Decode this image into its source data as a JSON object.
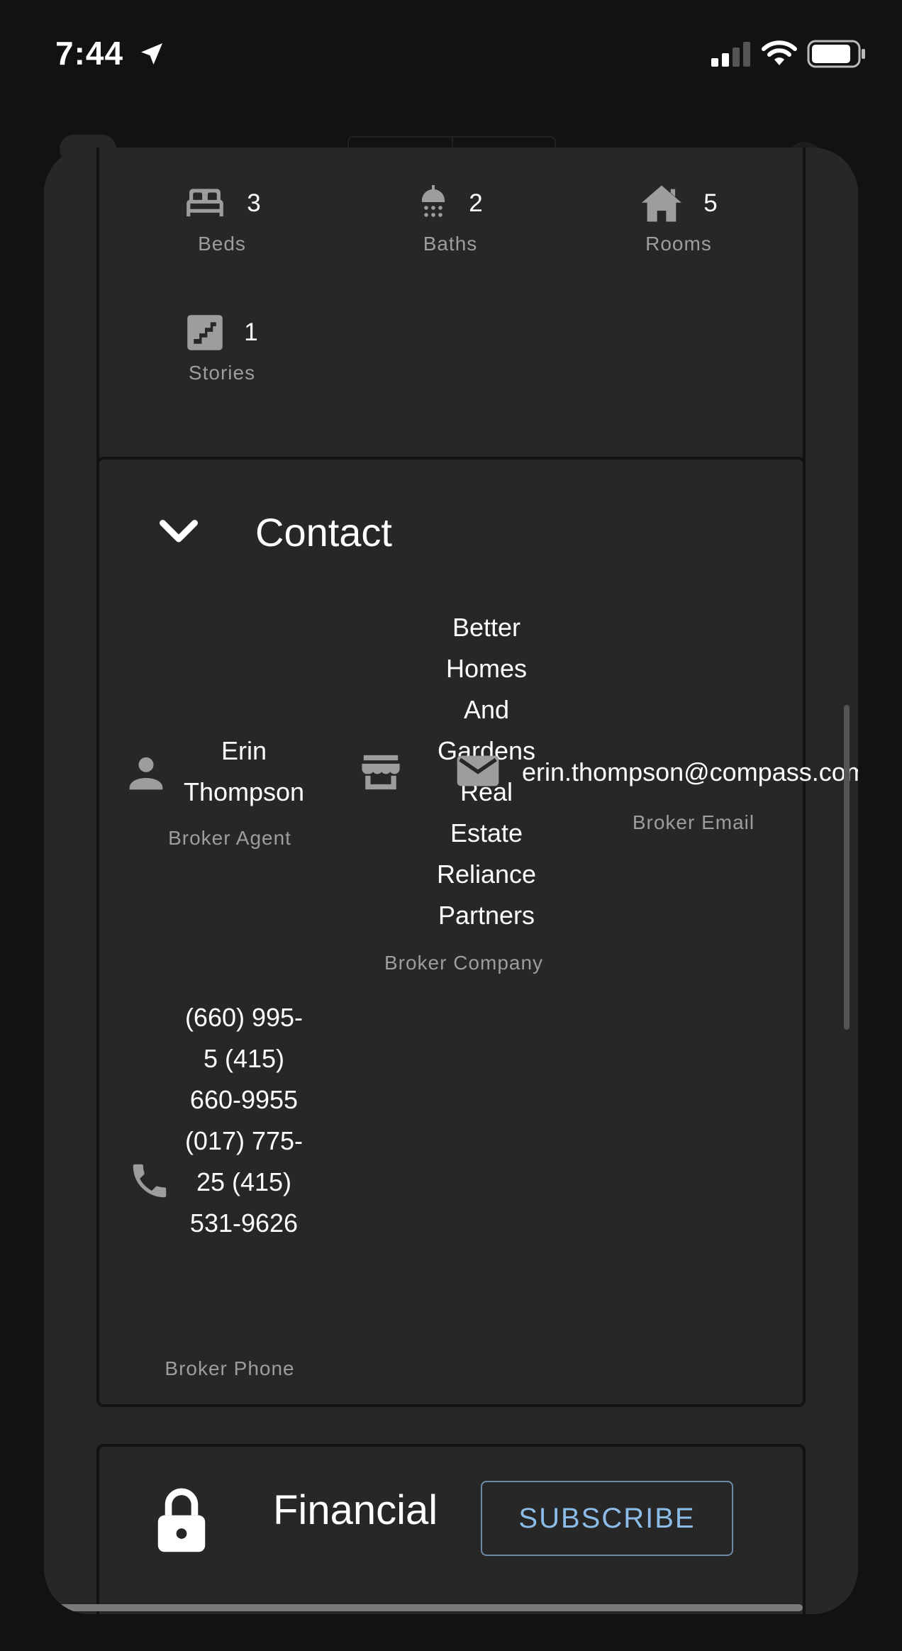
{
  "status_bar": {
    "time": "7:44"
  },
  "features": [
    {
      "icon": "bed-icon",
      "value": "3",
      "label": "Beds"
    },
    {
      "icon": "shower-icon",
      "value": "2",
      "label": "Baths"
    },
    {
      "icon": "house-icon",
      "value": "5",
      "label": "Rooms"
    },
    {
      "icon": "stairs-icon",
      "value": "1",
      "label": "Stories"
    }
  ],
  "contact": {
    "title": "Contact",
    "agent": {
      "icon": "person-icon",
      "value": "Erin Thompson",
      "label": "Broker Agent"
    },
    "company": {
      "icon": "store-icon",
      "value": "Better Homes And Gardens Real Estate Reliance Partners",
      "label": "Broker Company"
    },
    "email": {
      "icon": "mail-icon",
      "value": "erin.thompson@compass.com",
      "label": "Broker Email"
    },
    "phone": {
      "icon": "phone-icon",
      "value": "(660) 995-5 (415) 660-9955 (017) 775-25 (415) 531-9626",
      "label": "Broker Phone"
    }
  },
  "financial": {
    "icon": "lock-icon",
    "title": "Financial",
    "subscribe_label": "SUBSCRIBE"
  },
  "colors": {
    "background": "#121212",
    "card": "#272727",
    "accent": "#8cbde8",
    "muted_text": "#9d9d9d"
  }
}
